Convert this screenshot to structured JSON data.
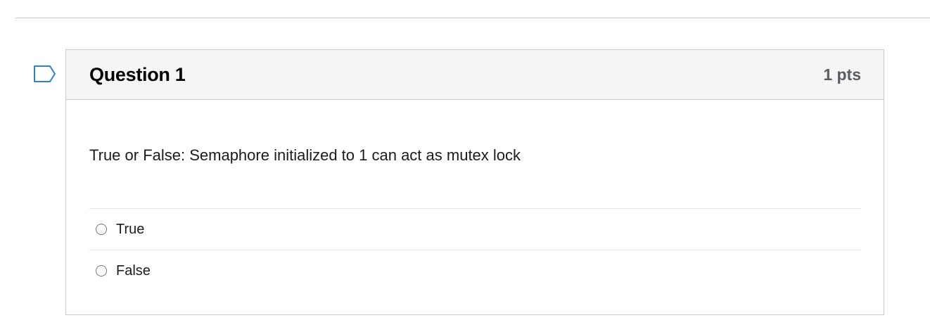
{
  "question": {
    "title": "Question 1",
    "points": "1 pts",
    "text": "True or False: Semaphore initialized to 1 can act as mutex lock",
    "answers": [
      {
        "label": "True",
        "selected": false
      },
      {
        "label": "False",
        "selected": false
      }
    ]
  },
  "icons": {
    "flag": "flag-question-icon"
  },
  "colors": {
    "header_bg": "#f5f5f5",
    "border": "#c7cdd1",
    "points_text": "#585d61",
    "flag_stroke": "#2d7fcf"
  }
}
